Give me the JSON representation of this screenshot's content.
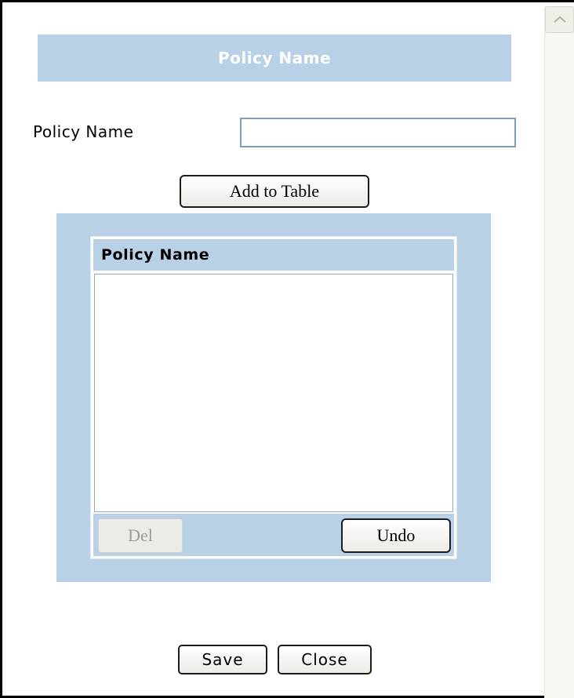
{
  "title_bar": {
    "title": "Policy Name"
  },
  "form": {
    "policy_name_label": "Policy Name",
    "policy_name_value": "",
    "add_button": "Add to Table"
  },
  "table": {
    "header": "Policy Name",
    "rows": [],
    "del_button": "Del",
    "undo_button": "Undo"
  },
  "footer": {
    "save_button": "Save",
    "close_button": "Close"
  },
  "colors": {
    "accent": "#b8d1e7",
    "input_border": "#7f9db9",
    "disabled_text": "#9b9b97"
  }
}
